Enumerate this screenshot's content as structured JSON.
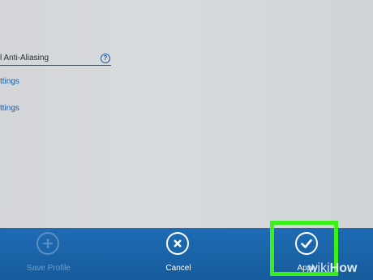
{
  "settings": {
    "antialiasing_label": "l Anti-Aliasing",
    "help_glyph": "?",
    "links": [
      {
        "label": "ttings"
      },
      {
        "label": "ttings"
      }
    ]
  },
  "toolbar": {
    "save_profile_label": "Save Profile",
    "save_profile_enabled": false,
    "cancel_label": "Cancel",
    "apply_label": "Apply"
  },
  "highlight": {
    "color": "#3bef1b",
    "target": "apply-button"
  },
  "watermark": {
    "part1": "wiki",
    "part2": "How"
  },
  "colors": {
    "bar": "#1a63a8",
    "link": "#1a5fa8"
  }
}
